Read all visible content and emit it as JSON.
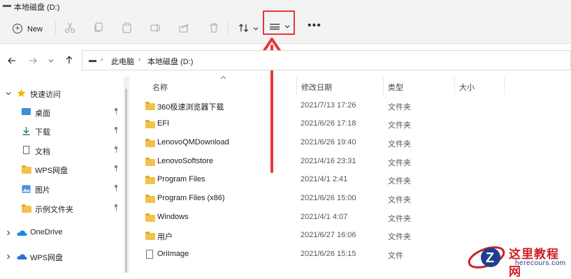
{
  "window": {
    "title": "本地磁盘 (D:)"
  },
  "toolbar": {
    "new_label": "New",
    "buttons": [
      "cut-icon",
      "copy-icon",
      "paste-icon",
      "rename-icon",
      "share-icon",
      "delete-icon"
    ],
    "sort_icon": "sort-icon",
    "view_icon": "view-list-icon",
    "more_label": "•••",
    "highlight_color": "#e8363a"
  },
  "address": {
    "breadcrumb": [
      "此电脑",
      "本地磁盘 (D:)"
    ],
    "separator": "›"
  },
  "nav": {
    "quick_access": {
      "label": "快速访问",
      "icon": "star-icon",
      "expanded": true
    },
    "items": [
      {
        "label": "桌面",
        "icon": "desktop-icon",
        "pinned": true
      },
      {
        "label": "下载",
        "icon": "download-icon",
        "pinned": true
      },
      {
        "label": "文档",
        "icon": "document-icon",
        "pinned": true
      },
      {
        "label": "WPS网盘",
        "icon": "folder-icon",
        "pinned": true
      },
      {
        "label": "图片",
        "icon": "picture-icon",
        "pinned": true
      },
      {
        "label": "示例文件夹",
        "icon": "folder-icon",
        "pinned": true
      }
    ],
    "onedrive": {
      "label": "OneDrive",
      "icon": "cloud-icon"
    },
    "wps": {
      "label": "WPS网盘",
      "icon": "cloud-icon"
    }
  },
  "columns": {
    "name": "名称",
    "date": "修改日期",
    "type": "类型",
    "size": "大小"
  },
  "files": [
    {
      "name": "360极速浏览器下载",
      "date": "2021/7/13 17:26",
      "type": "文件夹",
      "icon": "folder-icon"
    },
    {
      "name": "EFI",
      "date": "2021/6/26 17:18",
      "type": "文件夹",
      "icon": "folder-icon"
    },
    {
      "name": "LenovoQMDownload",
      "date": "2021/6/26 19:40",
      "type": "文件夹",
      "icon": "folder-icon"
    },
    {
      "name": "LenovoSoftstore",
      "date": "2021/4/16 23:31",
      "type": "文件夹",
      "icon": "folder-icon"
    },
    {
      "name": "Program Files",
      "date": "2021/4/1 2:41",
      "type": "文件夹",
      "icon": "folder-icon"
    },
    {
      "name": "Program Files (x86)",
      "date": "2021/6/26 15:00",
      "type": "文件夹",
      "icon": "folder-icon"
    },
    {
      "name": "Windows",
      "date": "2021/4/1 4:07",
      "type": "文件夹",
      "icon": "folder-icon"
    },
    {
      "name": "用户",
      "date": "2021/6/27 16:06",
      "type": "文件夹",
      "icon": "folder-icon"
    },
    {
      "name": "OriImage",
      "date": "2021/6/26 15:15",
      "type": "文件",
      "icon": "file-icon"
    }
  ],
  "watermark": {
    "title": "这里教程网",
    "url": "herecours.com"
  }
}
